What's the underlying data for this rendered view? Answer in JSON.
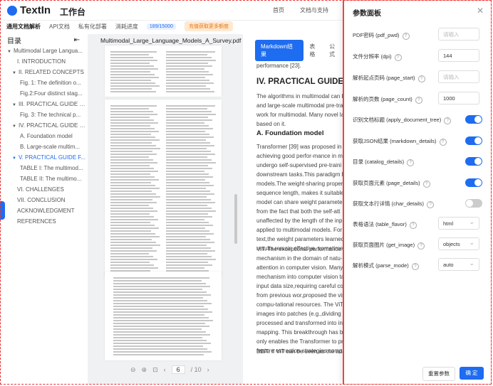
{
  "header": {
    "logo": "TextIn",
    "workbench": "工作台",
    "nav": [
      "首页",
      "文档与支持"
    ]
  },
  "subnav": {
    "items": [
      "通用文档解析",
      "API文档",
      "私有化部署"
    ],
    "quota_label": "消耗进度",
    "quota_value": "189/15000",
    "promo": "充值获取更多额度"
  },
  "toc": {
    "title": "目录",
    "items": [
      {
        "label": "Multimodal Large Langua...",
        "level": 0,
        "arrow": "▼",
        "active": false
      },
      {
        "label": "I. INTRODUCTION",
        "level": 1,
        "arrow": "",
        "active": false
      },
      {
        "label": "II. RELATED CONCEPTS",
        "level": 1,
        "arrow": "▼",
        "active": false
      },
      {
        "label": "Fig. 1: The definition o...",
        "level": 2,
        "arrow": "",
        "active": false
      },
      {
        "label": "Fig.2:Four distinct stag...",
        "level": 2,
        "arrow": "",
        "active": false
      },
      {
        "label": "III. PRACTICAL GUIDE F...",
        "level": 1,
        "arrow": "▼",
        "active": false
      },
      {
        "label": "Fig. 3: The technical p...",
        "level": 2,
        "arrow": "",
        "active": false
      },
      {
        "label": "IV. PRACTICAL GUIDE F...",
        "level": 1,
        "arrow": "▼",
        "active": false
      },
      {
        "label": "A. Foundation model",
        "level": 2,
        "arrow": "",
        "active": false
      },
      {
        "label": "B. Large-scale multim...",
        "level": 2,
        "arrow": "",
        "active": false
      },
      {
        "label": "V. PRACTICAL GUIDE F...",
        "level": 1,
        "arrow": "▼",
        "active": true
      },
      {
        "label": "TABLE I: The multimod...",
        "level": 2,
        "arrow": "",
        "active": false
      },
      {
        "label": "TABLE II: The multimo...",
        "level": 2,
        "arrow": "",
        "active": false
      },
      {
        "label": "VI. CHALLENGES",
        "level": 1,
        "arrow": "",
        "active": false
      },
      {
        "label": "VII. CONCLUSION",
        "level": 1,
        "arrow": "",
        "active": false
      },
      {
        "label": "ACKNOWLEDGMENT",
        "level": 1,
        "arrow": "",
        "active": false
      },
      {
        "label": "REFERENCES",
        "level": 1,
        "arrow": "",
        "active": false
      }
    ]
  },
  "viewer": {
    "file_name": "Multimodal_Large_Language_Models_A_Survey.pdf",
    "current_page": "6",
    "total_pages": "/ 10"
  },
  "content": {
    "tabs": [
      "Markdown结果",
      "表格",
      "公式"
    ],
    "text_top": "performance [23].",
    "heading": "IV. PRACTICAL GUIDE FO",
    "para1": [
      "The algorithms in multimodal can be",
      "and large-scale multimodal pre-tra",
      "work for multimodal. Many novel lar",
      "based on it."
    ],
    "subheading": "A. Foundation model",
    "para2": [
      "Transformer [39] was proposed in 2",
      "achieving good perfor-mance in mu",
      "undergo self-supervised pre-traini",
      "downstream tasks.This paradigm h",
      "models.The weight-sharing propert",
      "sequence length, makes it suitable",
      "model can share weight parameter",
      "from the fact that both the self-att",
      "unaffected by the length of the inp",
      "applied to multimodal models. For e",
      "text,the weight parameters learned",
      "results remain effective, sometime"
    ],
    "para3": [
      "ViT. The exceptional performance o",
      "mechanism in the domain of natu-r",
      "attention in computer vision. Many",
      "mechanism into computer vision ta",
      "input data size,requiring careful co",
      "from previous wor,proposed the vis",
      "compu-tational resources. The ViT",
      "images into patches (e.g.,dividing a",
      "processed and transformed into inp",
      "mapping. This breakthrough has bri",
      "only enables the Transformer to pr",
      "feature extraction strategies comp"
    ],
    "text_bottom": "BEiT. If ViT can be seen as the adap"
  },
  "panel": {
    "title": "参数面板",
    "rows": [
      {
        "label": "PDF密码 (pdf_pwd)",
        "type": "input",
        "value": "请输入",
        "placeholder": true
      },
      {
        "label": "文件分辨率 (dpi)",
        "type": "input",
        "value": "144",
        "placeholder": false
      },
      {
        "label": "解析起点页码 (page_start)",
        "type": "input",
        "value": "请输入",
        "placeholder": true
      },
      {
        "label": "解析的页数 (page_count)",
        "type": "input",
        "value": "1000",
        "placeholder": false
      },
      {
        "label": "识别文档标题 (apply_document_tree)",
        "type": "toggle",
        "on": true
      },
      {
        "label": "获取JSON结果 (markdown_details)",
        "type": "toggle",
        "on": true
      },
      {
        "label": "目录 (catalog_details)",
        "type": "toggle",
        "on": true
      },
      {
        "label": "获取页面元素 (page_details)",
        "type": "toggle",
        "on": true
      },
      {
        "label": "获取文本行详情 (char_details)",
        "type": "toggle",
        "on": false
      },
      {
        "label": "表格语法 (table_flavor)",
        "type": "select",
        "value": "html"
      },
      {
        "label": "获取页面图片 (get_image)",
        "type": "select",
        "value": "objects"
      },
      {
        "label": "解析模式 (parse_mode)",
        "type": "select",
        "value": "auto"
      }
    ],
    "reset_label": "重置参数",
    "confirm_label": "确 定"
  },
  "colors": {
    "accent": "#1e6cf0",
    "promo": "#e8740c",
    "frame": "#e33"
  }
}
